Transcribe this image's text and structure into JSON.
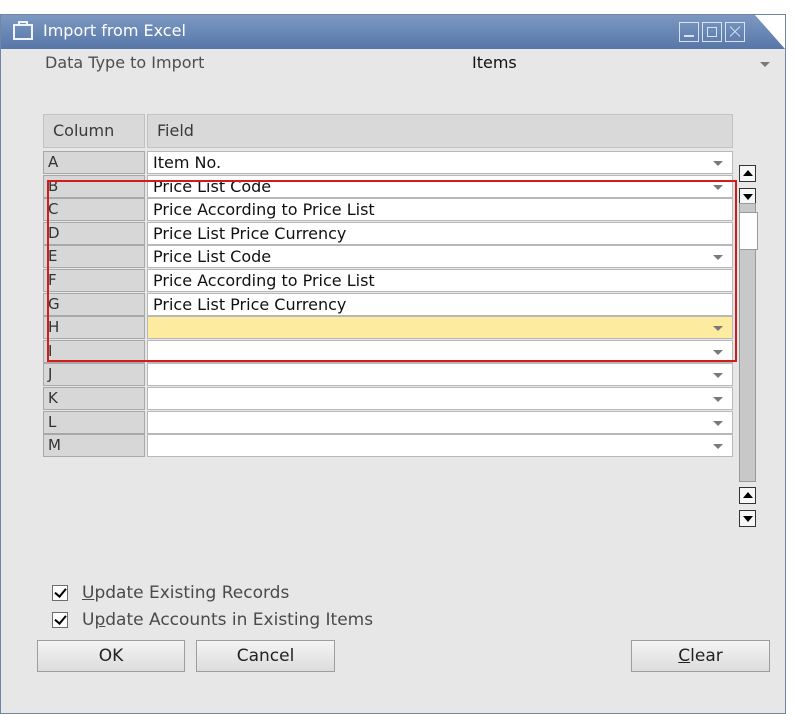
{
  "window": {
    "title": "Import from Excel"
  },
  "data_type": {
    "label": "Data Type to Import",
    "value": "Items"
  },
  "grid": {
    "headers": {
      "column": "Column",
      "field": "Field"
    },
    "rows": [
      {
        "col": "A",
        "field": "Item No.",
        "dropdown": true
      },
      {
        "col": "B",
        "field": "Price List Code",
        "dropdown": true
      },
      {
        "col": "C",
        "field": "Price According to Price List",
        "dropdown": false
      },
      {
        "col": "D",
        "field": "Price List Price Currency",
        "dropdown": false
      },
      {
        "col": "E",
        "field": "Price List Code",
        "dropdown": true
      },
      {
        "col": "F",
        "field": "Price According to Price List",
        "dropdown": false
      },
      {
        "col": "G",
        "field": "Price List Price Currency",
        "dropdown": false
      },
      {
        "col": "H",
        "field": "",
        "dropdown": true,
        "active": true
      },
      {
        "col": "I",
        "field": "",
        "dropdown": true
      },
      {
        "col": "J",
        "field": "",
        "dropdown": true
      },
      {
        "col": "K",
        "field": "",
        "dropdown": true
      },
      {
        "col": "L",
        "field": "",
        "dropdown": true
      },
      {
        "col": "M",
        "field": "",
        "dropdown": true
      }
    ]
  },
  "options": {
    "update_existing": {
      "label_mnemonic": "U",
      "label_rest": "pdate Existing Records",
      "checked": true
    },
    "update_accounts": {
      "label_pre": "U",
      "label_mnemonic": "p",
      "label_rest": "date Accounts in Existing Items",
      "checked": true
    }
  },
  "buttons": {
    "ok": "OK",
    "cancel": "Cancel",
    "clear_mnemonic": "C",
    "clear_rest": "lear"
  },
  "colors": {
    "titlebar": "#6786b5",
    "highlight": "#d21b1b",
    "active_row": "#fdeba0"
  },
  "icons": [
    "window-icon",
    "minimize-icon",
    "maximize-icon",
    "close-icon",
    "dropdown-caret-icon",
    "scroll-up-icon",
    "scroll-down-icon",
    "checkmark-icon"
  ]
}
